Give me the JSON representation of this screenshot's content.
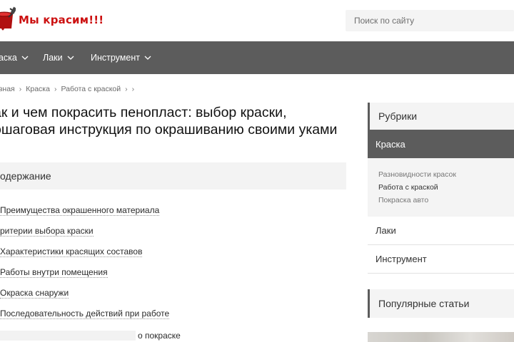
{
  "header": {
    "logo_text": "Мы красим!!!",
    "logo_icon": "paint-bucket-icon",
    "search_placeholder": "Поиск по сайту"
  },
  "nav": {
    "items": [
      {
        "label": "раска",
        "icon": "chevron-down-icon"
      },
      {
        "label": "Лаки",
        "icon": "chevron-down-icon"
      },
      {
        "label": "Инструмент",
        "icon": "chevron-down-icon"
      }
    ]
  },
  "breadcrumb": {
    "items": [
      "авная",
      "Краска",
      "Работа с краской"
    ],
    "separator": "›",
    "trailing": "›"
  },
  "article": {
    "title": "ак и чем покрасить пенопласт: выбор краски, ошаговая инструкция по окрашиванию своими уками"
  },
  "toc": {
    "heading": "одержание",
    "items": [
      "Преимущества окрашенного материала",
      "ритерии выбора краски",
      "Характеристики красящих составов",
      "Работы внутри помещения",
      "Окраска снаружи",
      "Последовательность действий при работе"
    ],
    "last_item_tail": "о покраске"
  },
  "sidebar": {
    "rubrics_title": "Рубрики",
    "active_category": "Краска",
    "subcategories": [
      "Разновидности красок",
      "Работа с краской",
      "Покраска авто"
    ],
    "other_categories": [
      "Лаки",
      "Инструмент"
    ],
    "popular_title": "Популярные статьи"
  },
  "colors": {
    "accent": "#5c5c5c",
    "logo_red": "#cc1111",
    "panel_bg": "#f4f4f4"
  }
}
